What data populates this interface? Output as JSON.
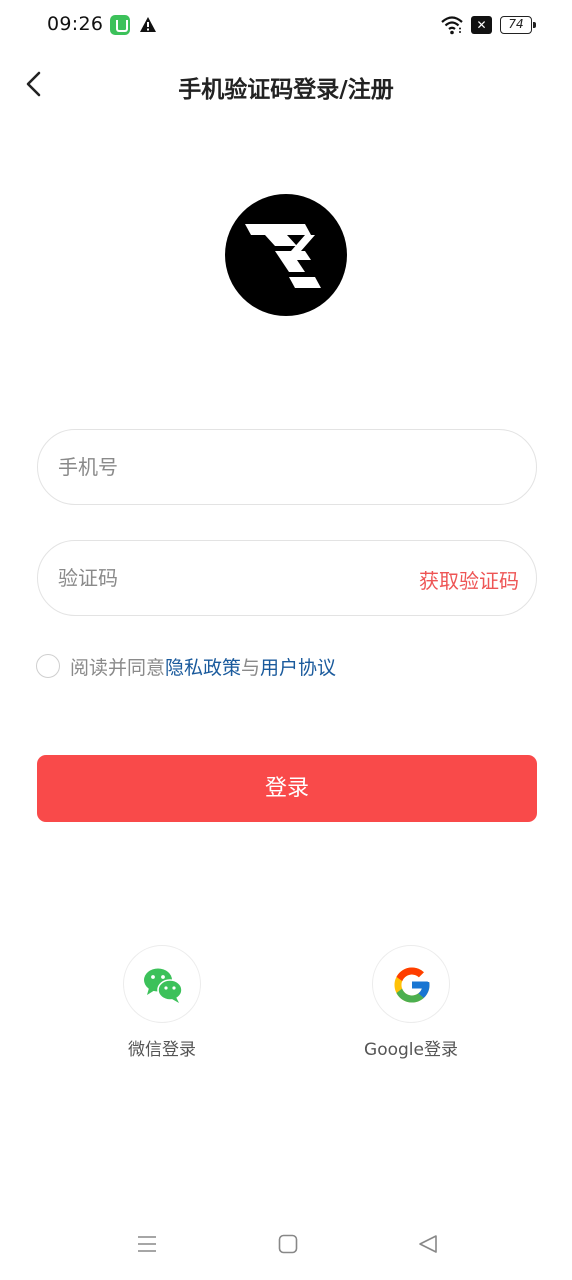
{
  "status_bar": {
    "time": "09:26",
    "battery": "74",
    "icons": [
      "app-icon",
      "warning-icon",
      "wifi-icon",
      "x-icon",
      "battery-icon"
    ]
  },
  "header": {
    "title": "手机验证码登录/注册",
    "back_icon": "chevron-left-icon"
  },
  "form": {
    "phone_placeholder": "手机号",
    "phone_value": "",
    "code_placeholder": "验证码",
    "code_value": "",
    "get_code_label": "获取验证码"
  },
  "agreement": {
    "prefix": "阅读并同意",
    "privacy_link": "隐私政策",
    "conjunction": "与",
    "terms_link": "用户协议",
    "checked": false
  },
  "login_button": {
    "label": "登录"
  },
  "social": {
    "wechat_label": "微信登录",
    "google_label": "Google登录"
  },
  "colors": {
    "accent": "#f94a4a",
    "link": "#1a5a9c",
    "get_code": "#ee5555",
    "wechat_green": "#3cc15a"
  }
}
